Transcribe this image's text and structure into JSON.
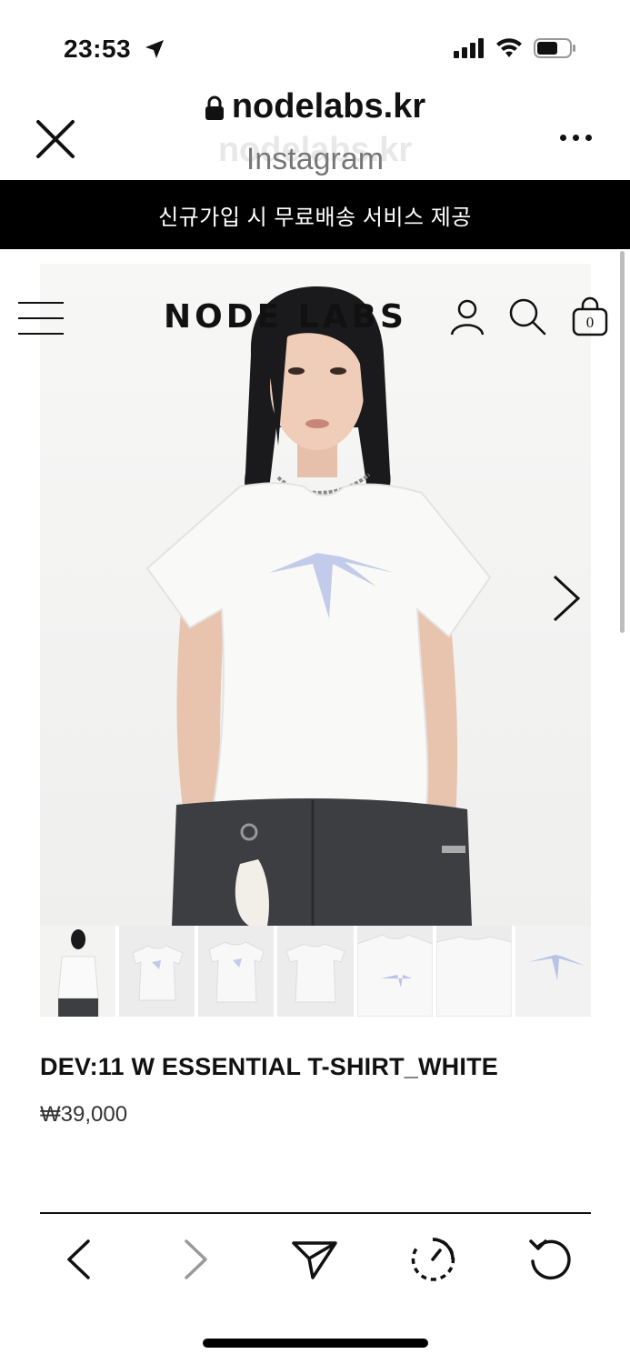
{
  "status_bar": {
    "time": "23:53",
    "icons": [
      "location-arrow-icon",
      "signal-icon",
      "wifi-icon",
      "battery-icon"
    ]
  },
  "browser": {
    "url": "nodelabs.kr",
    "source": "Instagram",
    "close_icon": "close-icon",
    "more_icon": "more-icon"
  },
  "banner": {
    "text": "신규가입 시 무료배송 서비스 제공"
  },
  "site_nav": {
    "logo": "NODE LABS",
    "cart_count": "0",
    "icons": [
      "menu-icon",
      "user-icon",
      "search-icon",
      "cart-icon"
    ]
  },
  "gallery": {
    "next_icon": "chevron-right-icon",
    "thumbnail_count": 7
  },
  "product": {
    "name": "DEV:11 W ESSENTIAL T-SHIRT_WHITE",
    "price": "₩39,000"
  },
  "toolbar": {
    "icons": [
      "back-icon",
      "forward-icon",
      "share-icon",
      "history-icon",
      "reload-icon"
    ]
  },
  "colors": {
    "banner_bg": "#000000",
    "shirt_logo": "#b9c3e6"
  }
}
